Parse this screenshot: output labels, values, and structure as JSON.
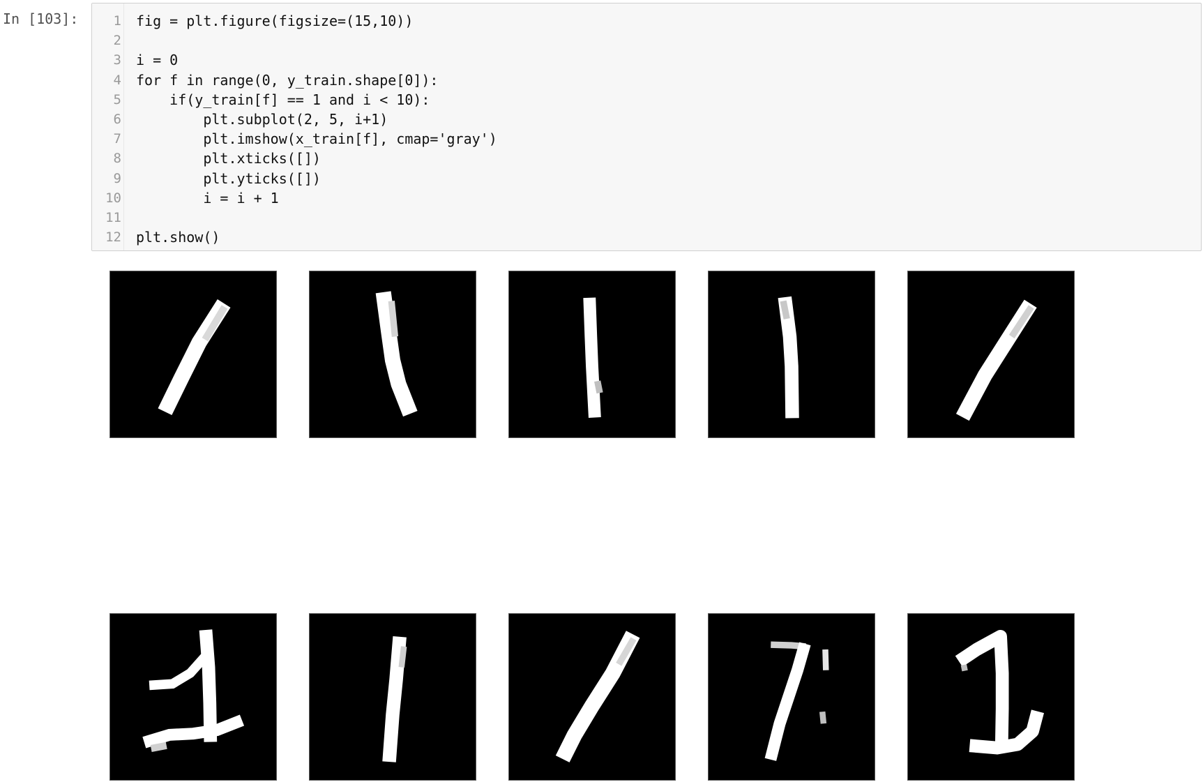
{
  "cell": {
    "prompt": "In [103]:",
    "lines": [
      {
        "n": "1",
        "code": "fig = plt.figure(figsize=(15,10))"
      },
      {
        "n": "2",
        "code": ""
      },
      {
        "n": "3",
        "code": "i = 0"
      },
      {
        "n": "4",
        "code": "for f in range(0, y_train.shape[0]):"
      },
      {
        "n": "5",
        "code": "    if(y_train[f] == 1 and i < 10):"
      },
      {
        "n": "6",
        "code": "        plt.subplot(2, 5, i+1)"
      },
      {
        "n": "7",
        "code": "        plt.imshow(x_train[f], cmap='gray')"
      },
      {
        "n": "8",
        "code": "        plt.xticks([])"
      },
      {
        "n": "9",
        "code": "        plt.yticks([])"
      },
      {
        "n": "10",
        "code": "        i = i + 1"
      },
      {
        "n": "11",
        "code": ""
      },
      {
        "n": "12",
        "code": "plt.show()"
      }
    ]
  },
  "output": {
    "grid": {
      "rows": 2,
      "cols": 5
    },
    "colors": {
      "panel_bg": "#000000",
      "stroke": "#ffffff"
    },
    "images": [
      {
        "name": "digit-one-1"
      },
      {
        "name": "digit-one-2"
      },
      {
        "name": "digit-one-3"
      },
      {
        "name": "digit-one-4"
      },
      {
        "name": "digit-one-5"
      },
      {
        "name": "digit-one-6"
      },
      {
        "name": "digit-one-7"
      },
      {
        "name": "digit-one-8"
      },
      {
        "name": "digit-one-9"
      },
      {
        "name": "digit-one-10"
      }
    ]
  }
}
